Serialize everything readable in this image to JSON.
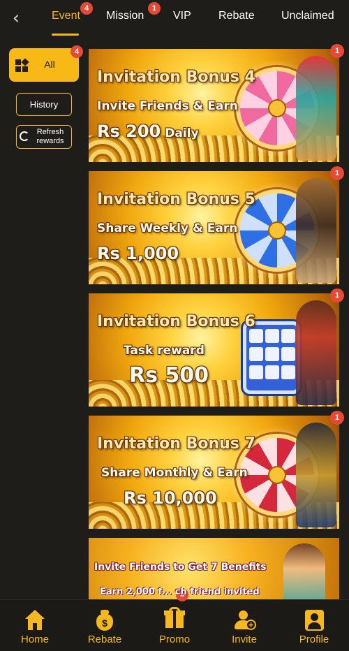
{
  "topbar": {
    "tabs": [
      {
        "label": "Event",
        "badge": "4"
      },
      {
        "label": "Mission",
        "badge": "1"
      },
      {
        "label": "VIP"
      },
      {
        "label": "Rebate"
      },
      {
        "label": "Unclaimed"
      }
    ],
    "back_icon": "chevron-left-icon",
    "active_color": "#f6b81c"
  },
  "sidebar": {
    "all": {
      "label": "All",
      "badge": "4",
      "icon": "grid-icon"
    },
    "history": {
      "label": "History"
    },
    "refresh": {
      "label_line1": "Refresh",
      "label_line2": "rewards",
      "icon": "refresh-icon"
    }
  },
  "banners": [
    {
      "title": "Invitation Bonus 4",
      "subtitle": "Invite Friends & Earn",
      "amount": "Rs 200",
      "amount_suffix": "Daily",
      "badge": "1",
      "art": "pink-wheel"
    },
    {
      "title": "Invitation Bonus 5",
      "subtitle": "Share Weekly & Earn",
      "amount": "Rs 1,000",
      "badge": "1",
      "art": "blue-wheel"
    },
    {
      "title": "Invitation Bonus 6",
      "subtitle": "Task reward",
      "amount": "Rs 500",
      "badge": "1",
      "art": "slot-machine"
    },
    {
      "title": "Invitation Bonus 7",
      "subtitle": "Share Monthly & Earn",
      "amount": "Rs 10,000",
      "badge": "1",
      "art": "red-wheel"
    },
    {
      "title": "Invite Friends to Get  7 Benefits",
      "subtitle": "Earn 2,000 f... ch friend invited"
    }
  ],
  "bottom_nav": [
    {
      "label": "Home",
      "icon": "home-icon"
    },
    {
      "label": "Rebate",
      "icon": "money-bag-icon"
    },
    {
      "label": "Promo",
      "icon": "gift-icon",
      "badge": "5"
    },
    {
      "label": "Invite",
      "icon": "add-user-icon"
    },
    {
      "label": "Profile",
      "icon": "profile-icon"
    }
  ],
  "colors": {
    "accent": "#f6b81c",
    "badge": "#e64a35",
    "background": "#1f1d1a"
  }
}
